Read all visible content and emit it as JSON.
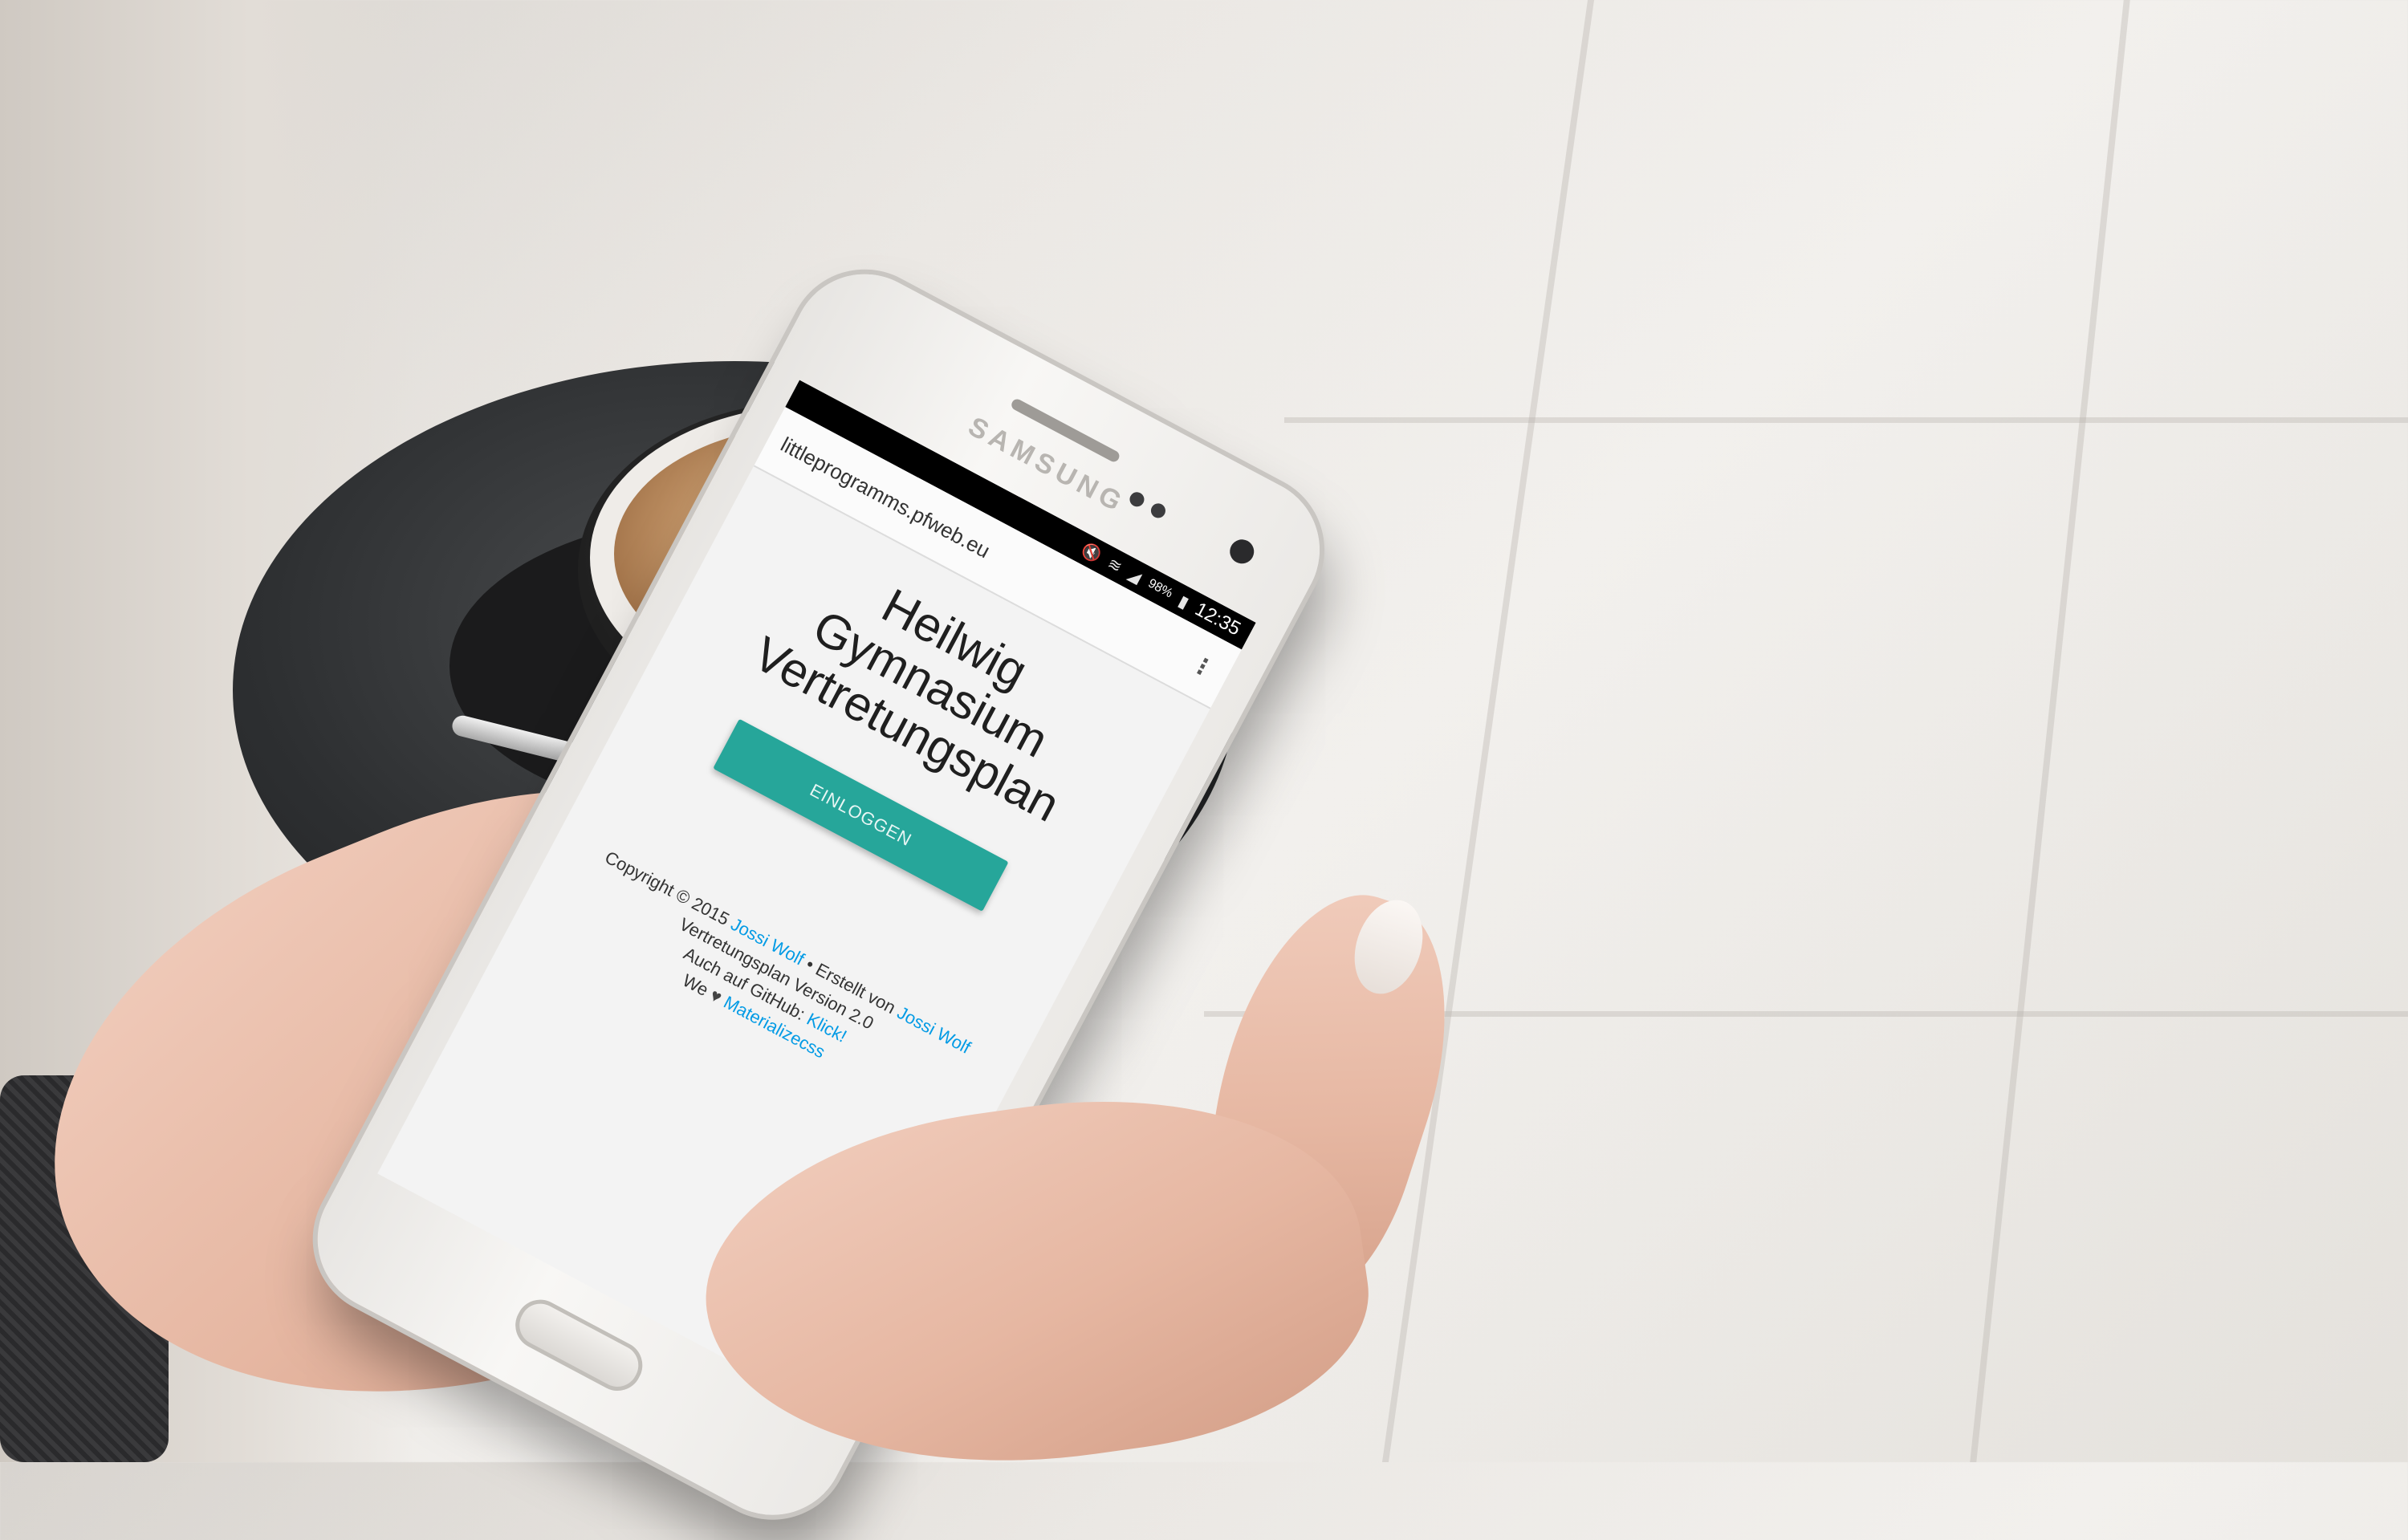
{
  "device": {
    "brand": "SAMSUNG"
  },
  "status_bar": {
    "battery": "98%",
    "time": "12:35",
    "icons": [
      "muted-icon",
      "wifi-icon",
      "signal-icon",
      "battery-icon"
    ]
  },
  "browser": {
    "url": "littleprogramms.pfweb.eu",
    "menu_icon": "overflow-menu-icon"
  },
  "page": {
    "title_lines": [
      "Heilwig",
      "Gymnasium",
      "Vertretungsplan"
    ],
    "login_button": "EINLOGGEN",
    "footer": {
      "copyright_prefix": "Copyright © 2015",
      "author_link": "Jossi Wolf",
      "created_by": "• Erstellt von",
      "author_link_2": "Jossi Wolf",
      "version": "Vertretungsplan Version 2.0",
      "github_prefix": "Auch auf GitHub:",
      "github_link": "Klick!",
      "we": "We",
      "heart_icon": "heart-icon",
      "materialize_link": "Materializecss"
    },
    "colors": {
      "accent": "#26a69a",
      "link": "#039be5"
    }
  }
}
